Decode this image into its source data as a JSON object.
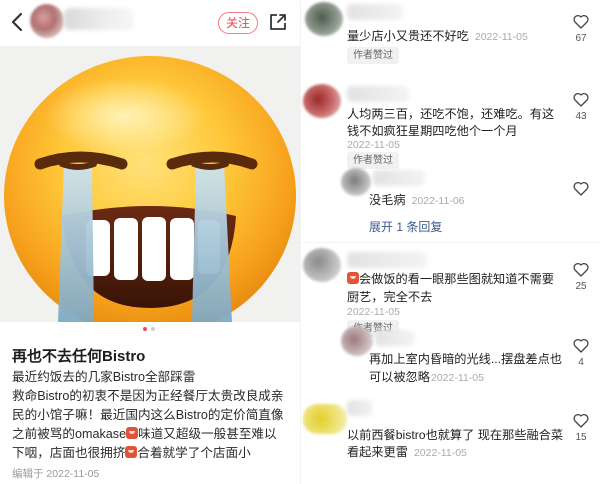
{
  "post": {
    "follow_label": "关注",
    "title": "再也不去任何Bistro",
    "body_lines": [
      "最近约饭去的几家Bistro全部踩雷",
      "救命Bistro的初衷不是因为正经餐厅太贵改良成亲",
      "民的小馆子嘛！最近国内这么Bistro的定价简直像",
      "之前被骂的omakase",
      "味道又超级一般甚至难以",
      "下咽，店面也很拥挤",
      "合着就学了个店面小"
    ],
    "edited_label": "编辑于",
    "edited_date": "2022-11-05",
    "image_alt": "crying-laughing-emoji",
    "carousel": {
      "count": 2,
      "active": 0
    },
    "colors": {
      "accent": "#e8434f",
      "dot_active": "#ee4a56",
      "dot_inactive": "#cfcfcf"
    }
  },
  "comments": [
    {
      "text": "量少店小又贵还不好吃",
      "date": "2022-11-05",
      "author_liked": "作者赞过",
      "likes": "67"
    },
    {
      "text_lines": [
        "人均两三百，还吃不饱，还难吃。有这",
        "钱不如疯狂星期四吃他个一个月"
      ],
      "date": "2022-11-05",
      "author_liked": "作者赞过",
      "likes": "43"
    },
    {
      "text": "没毛病",
      "date": "2022-11-06",
      "expand": "展开 1 条回复",
      "likes": ""
    },
    {
      "text_lines": [
        "会做饭的看一眼那些图就知道不需要",
        "厨艺，完全不去"
      ],
      "date": "2022-11-05",
      "author_liked": "作者赞过",
      "likes": "25"
    },
    {
      "text_lines": [
        "再加上室内昏暗的光线...摆盘差点也",
        "可以被忽略"
      ],
      "date": "2022-11-05",
      "likes": "4"
    },
    {
      "text_lines": [
        "以前西餐bistro也就算了 现在那些融合菜",
        "看起来更雷"
      ],
      "date": "2022-11-05",
      "likes": "15"
    }
  ],
  "icons": {
    "back": "chevron-left-icon",
    "share": "share-icon",
    "like": "heart-outline-icon",
    "emoji": "red-face-emoji-icon"
  }
}
